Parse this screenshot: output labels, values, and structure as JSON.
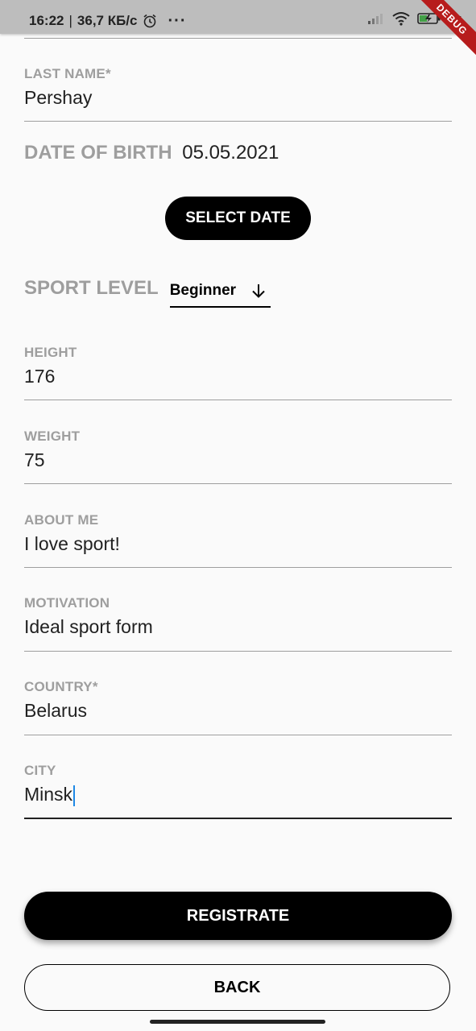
{
  "status_bar": {
    "time": "16:22",
    "separator": "|",
    "network_speed": "36,7 КБ/с",
    "more": "···",
    "battery": "37",
    "debug_label": "DEBUG"
  },
  "form": {
    "last_name": {
      "label": "LAST NAME*",
      "value": "Pershay"
    },
    "date_of_birth": {
      "label": "DATE OF BIRTH",
      "value": "05.05.2021"
    },
    "select_date_label": "SELECT DATE",
    "sport_level": {
      "label": "SPORT LEVEL",
      "value": "Beginner"
    },
    "height": {
      "label": "HEIGHT",
      "value": "176"
    },
    "weight": {
      "label": "WEIGHT",
      "value": "75"
    },
    "about_me": {
      "label": "ABOUT ME",
      "value": "I love sport!"
    },
    "motivation": {
      "label": "MOTIVATION",
      "value": "Ideal sport form"
    },
    "country": {
      "label": "COUNTRY*",
      "value": "Belarus"
    },
    "city": {
      "label": "CITY",
      "value": "Minsk"
    }
  },
  "actions": {
    "registrate_label": "REGISTRATE",
    "back_label": "BACK"
  },
  "colors": {
    "accent": "#000000",
    "label_gray": "#9e9e9e",
    "cursor": "#1e88e5",
    "debug_banner": "#b71c1c"
  },
  "icons": [
    "alarm-icon",
    "signal-icon",
    "wifi-icon",
    "battery-charging-icon",
    "arrow-down-icon"
  ]
}
